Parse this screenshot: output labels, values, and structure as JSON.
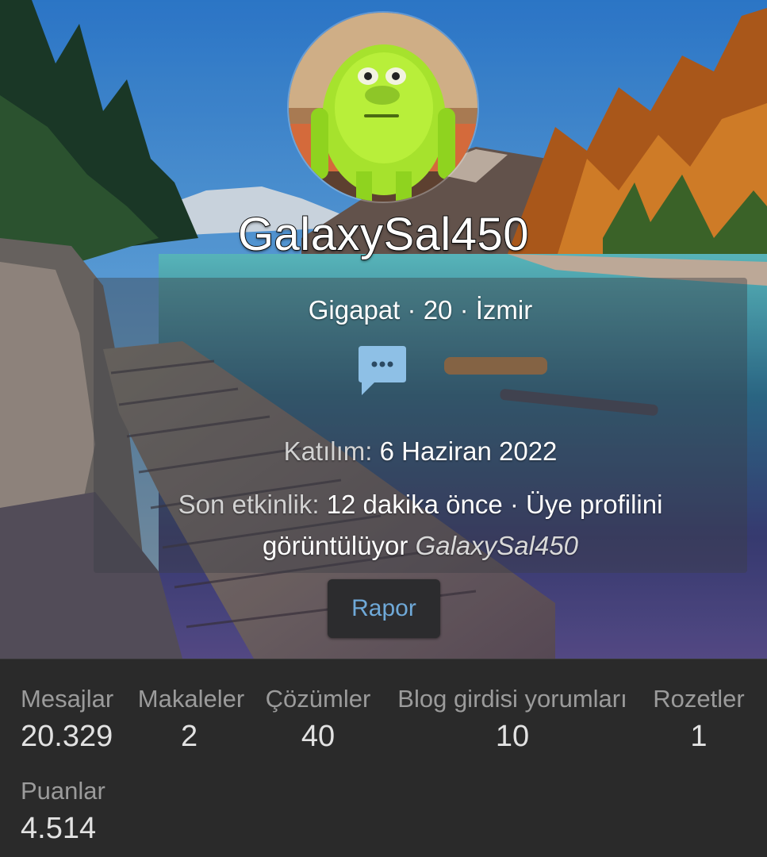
{
  "profile": {
    "username": "GalaxySal450",
    "title": "Gigapat",
    "age": "20",
    "location": "İzmir",
    "separator": " · "
  },
  "info": {
    "joined_label": "Katılım:",
    "joined_value": "6 Haziran 2022",
    "activity_label": "Son etkinlik:",
    "activity_time": "12 dakika önce",
    "activity_action": "· Üye profilini görüntülüyor",
    "activity_target": "GalaxySal450",
    "message_icon": "chat-bubble-icon"
  },
  "report_button": {
    "label": "Rapor"
  },
  "stats": [
    {
      "label": "Mesajlar",
      "value": "20.329"
    },
    {
      "label": "Makaleler",
      "value": "2"
    },
    {
      "label": "Çözümler",
      "value": "40"
    },
    {
      "label": "Blog girdisi yorumları",
      "value": "10"
    },
    {
      "label": "Rozetler",
      "value": "1"
    },
    {
      "label": "Puanlar",
      "value": "4.514"
    }
  ],
  "colors": {
    "accent": "#6fa9d8",
    "message_icon": "#8ec0e6",
    "stats_bg": "#2a2a2a"
  }
}
